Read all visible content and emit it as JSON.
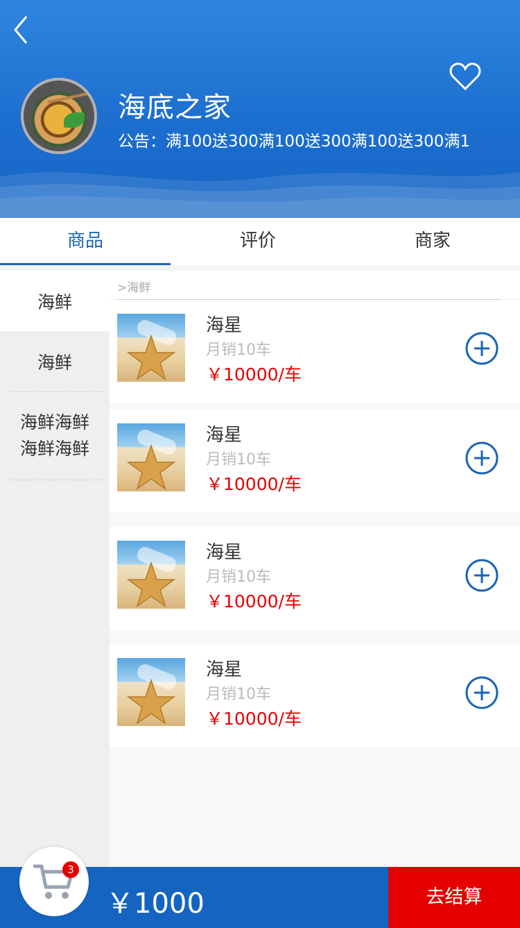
{
  "shop": {
    "name": "海底之家",
    "notice": "公告：满100送300满100送300满100送300满1"
  },
  "tabs": [
    {
      "label": "商品",
      "active": true
    },
    {
      "label": "评价",
      "active": false
    },
    {
      "label": "商家",
      "active": false
    }
  ],
  "sidebar": {
    "items": [
      {
        "label": "海鲜",
        "active": true
      },
      {
        "label": "海鲜",
        "active": false
      },
      {
        "label": "海鲜海鲜海鲜海鲜",
        "active": false
      }
    ]
  },
  "category_breadcrumb": ">海鲜",
  "products": [
    {
      "name": "海星",
      "sales": "月销10车",
      "price": "￥10000/车"
    },
    {
      "name": "海星",
      "sales": "月销10车",
      "price": "￥10000/车"
    },
    {
      "name": "海星",
      "sales": "月销10车",
      "price": "￥10000/车"
    },
    {
      "name": "海星",
      "sales": "月销10车",
      "price": "￥10000/车"
    }
  ],
  "cart": {
    "count": "3",
    "total": "￥1000",
    "checkout_label": "去结算"
  },
  "icons": {
    "back": "chevron-left-icon",
    "favorite": "heart-outline-icon",
    "add": "plus-circle-icon",
    "cart": "shopping-cart-icon"
  },
  "colors": {
    "header": "#1d6fcf",
    "accent": "#1b64b8",
    "price": "#e50000",
    "checkout": "#e50000",
    "bottom_bar": "#1565c0"
  }
}
